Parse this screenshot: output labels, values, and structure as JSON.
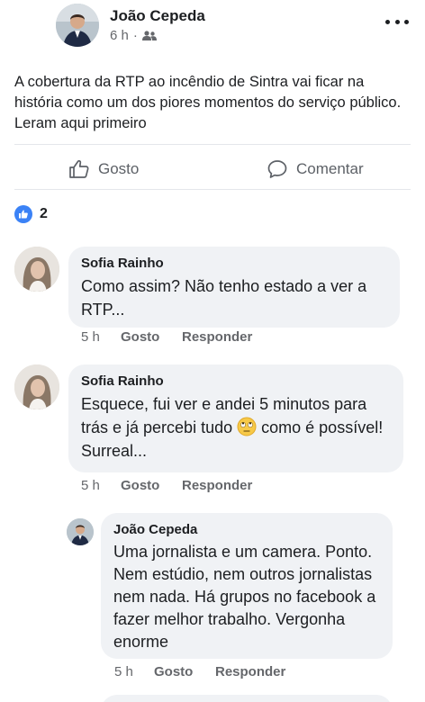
{
  "post": {
    "author": "João Cepeda",
    "time": "6 h",
    "separator": "·",
    "audience_icon": "friends-icon",
    "text": "A cobertura da RTP ao incêndio de Sintra vai ficar na história como um dos piores momentos do serviço público. Leram aqui primeiro"
  },
  "actions": {
    "like_label": "Gosto",
    "comment_label": "Comentar"
  },
  "reactions": {
    "count": "2",
    "icon": "like-icon"
  },
  "comments": [
    {
      "author": "Sofia Rainho",
      "text": "Como assim? Não tenho estado a ver a RTP...",
      "time": "5 h",
      "like_label": "Gosto",
      "reply_label": "Responder"
    },
    {
      "author": "Sofia Rainho",
      "text_before": "Esquece, fui ver e andei 5 minutos para trás e já percebi tudo",
      "emoji": "eye-roll-emoji",
      "text_after": "como é possível! Surreal...",
      "time": "5 h",
      "like_label": "Gosto",
      "reply_label": "Responder"
    },
    {
      "author": "João Cepeda",
      "text": "Uma jornalista e um camera. Ponto. Nem estúdio, nem outros jornalistas nem nada. Há grupos no facebook a fazer melhor trabalho. Vergonha enorme",
      "time": "5 h",
      "like_label": "Gosto",
      "reply_label": "Responder"
    }
  ],
  "colors": {
    "text": "#1c1e21",
    "muted": "#65676b",
    "bubble": "#f0f2f5",
    "like_blue": "#3b82f6",
    "divider": "#e4e6eb"
  }
}
